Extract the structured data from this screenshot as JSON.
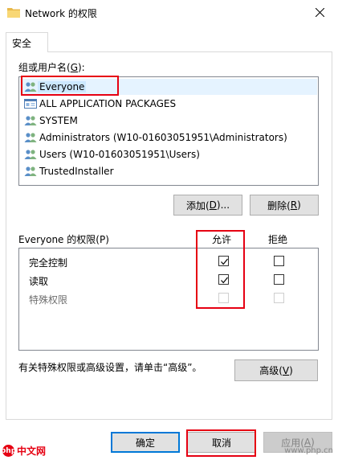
{
  "window": {
    "title": "Network 的权限"
  },
  "tabs": [
    {
      "label": "安全"
    }
  ],
  "group": {
    "label_prefix": "组或用户名(",
    "label_key": "G",
    "label_suffix": "):",
    "users": [
      {
        "name": "Everyone"
      },
      {
        "name": "ALL APPLICATION PACKAGES"
      },
      {
        "name": "SYSTEM"
      },
      {
        "name": "Administrators (W10-01603051951\\Administrators)"
      },
      {
        "name": "Users (W10-01603051951\\Users)"
      },
      {
        "name": "TrustedInstaller"
      }
    ],
    "selected_index": 0
  },
  "buttons": {
    "add_prefix": "添加(",
    "add_key": "D",
    "add_suffix": ")...",
    "remove_prefix": "删除(",
    "remove_key": "R",
    "remove_suffix": ")",
    "advanced_prefix": "高级(",
    "advanced_key": "V",
    "advanced_suffix": ")",
    "ok": "确定",
    "cancel": "取消",
    "apply_prefix": "应用(",
    "apply_key": "A",
    "apply_suffix": ")"
  },
  "permissions": {
    "header_prefix": "Everyone 的权限(",
    "header_key": "P",
    "header_suffix": ")",
    "allow_header": "允许",
    "deny_header": "拒绝",
    "rows": [
      {
        "label": "完全控制",
        "allow": true,
        "deny": false,
        "enabled": true
      },
      {
        "label": "读取",
        "allow": true,
        "deny": false,
        "enabled": true
      },
      {
        "label": "特殊权限",
        "allow": false,
        "deny": false,
        "enabled": false
      }
    ]
  },
  "advanced_note": "有关特殊权限或高级设置，请单击“高级”。",
  "watermark": {
    "left_logo": "php",
    "left_text": "中文网",
    "right_text": "www.php.cn"
  },
  "colors": {
    "highlight_red": "#e60012",
    "selection": "#cce8ff",
    "accent": "#0078d7"
  }
}
